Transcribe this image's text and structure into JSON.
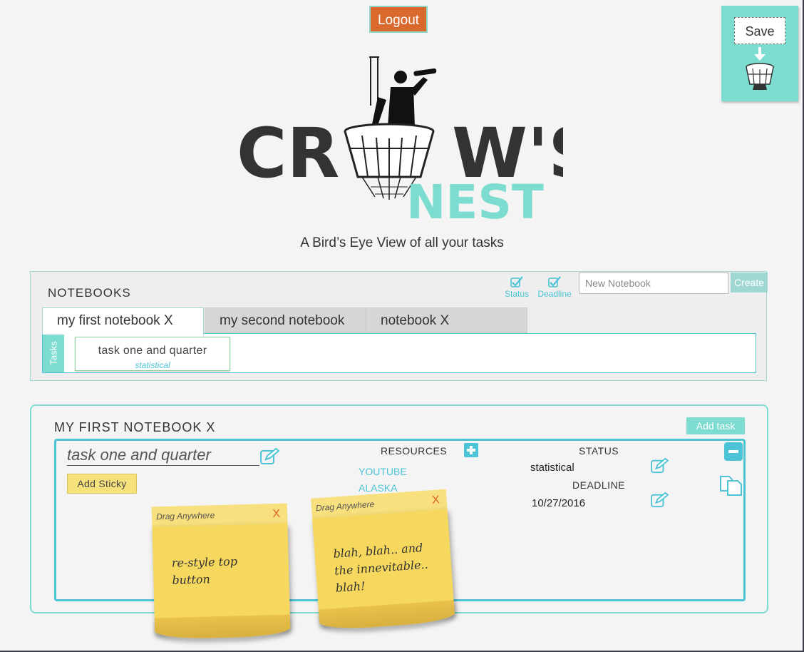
{
  "header": {
    "logout_label": "Logout",
    "save_label": "Save",
    "logo_word_1": "CR",
    "logo_word_2": "W'S",
    "logo_word_3": "NEST",
    "tagline": "A Bird’s Eye View of all your tasks"
  },
  "notebooks": {
    "title": "NOTEBOOKS",
    "status_label": "Status",
    "deadline_label": "Deadline",
    "new_placeholder": "New Notebook",
    "create_label": "Create",
    "tabs": [
      {
        "label": "my first notebook X"
      },
      {
        "label": "my second notebook"
      },
      {
        "label": "notebook X"
      }
    ],
    "tasks_label": "Tasks",
    "tasks": [
      {
        "title": "task one and quarter",
        "status": "statistical"
      }
    ]
  },
  "notebook": {
    "title": "MY FIRST NOTEBOOK X",
    "add_task_label": "Add task",
    "task": {
      "name": "task one and quarter",
      "add_sticky_label": "Add Sticky",
      "resources_header": "RESOURCES",
      "resources": [
        "YOUTUBE",
        "ALASKA"
      ],
      "status_header": "STATUS",
      "status_value": "statistical",
      "deadline_header": "DEADLINE",
      "deadline_value": "10/27/2016"
    }
  },
  "stickies": [
    {
      "header": "Drag Anywhere",
      "close": "X",
      "text": "re-style top button"
    },
    {
      "header": "Drag Anywhere",
      "close": "X",
      "text": "blah, blah.. and the innevitable.. blah!"
    }
  ],
  "colors": {
    "accent": "#7ddcd0",
    "accent_dark": "#4dc4d4",
    "logout": "#d9692c",
    "sticky": "#f7d85e"
  }
}
